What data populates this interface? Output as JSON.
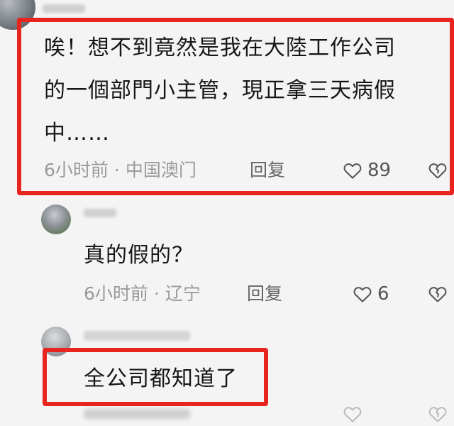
{
  "comments": [
    {
      "lines": [
        "唉！想不到竟然是我在大陸工作公司",
        "的一個部門小主管，現正拿三天病假",
        "中……"
      ],
      "time": "6小时前",
      "location": "中国澳门",
      "reply_label": "回复",
      "likes": "89"
    },
    {
      "lines": [
        "真的假的？"
      ],
      "time": "6小时前",
      "location": "辽宁",
      "reply_label": "回复",
      "likes": "6"
    },
    {
      "lines": [
        "全公司都知道了"
      ],
      "time": "",
      "location": "",
      "reply_label": "",
      "likes": ""
    }
  ],
  "colors": {
    "highlight": "#e8241f",
    "meta": "#9a9a9a",
    "text": "#161616"
  },
  "icons": {
    "like": "heart-outline-icon",
    "dislike": "broken-heart-icon"
  }
}
